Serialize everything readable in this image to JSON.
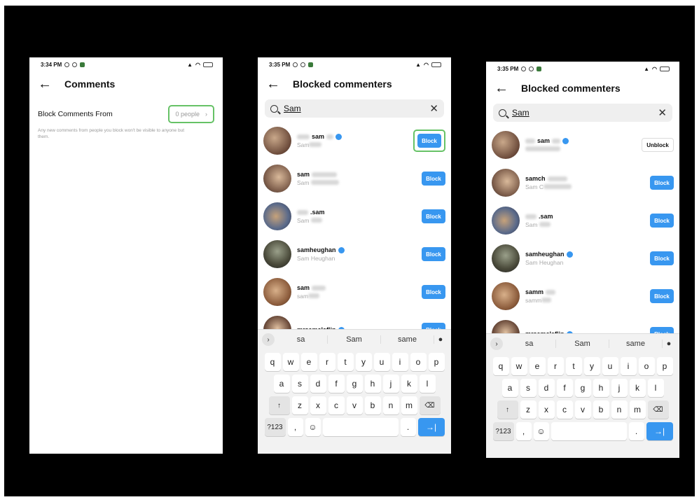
{
  "screens": {
    "p1": {
      "status_time": "3:34 PM",
      "title": "Comments",
      "block_label": "Block Comments From",
      "people_value": "0 people",
      "hint": "Any new comments from people you block won't be visible to anyone but them."
    },
    "p2": {
      "status_time": "3:35 PM",
      "title": "Blocked commenters",
      "search_value": "Sam",
      "rows": [
        {
          "username": "sam",
          "fullname": "Sam",
          "action": "Block",
          "verified": true
        },
        {
          "username": "sam",
          "fullname": "Sam",
          "action": "Block",
          "verified": false
        },
        {
          "username": ".sam",
          "fullname": "Sam",
          "action": "Block",
          "verified": false
        },
        {
          "username": "samheughan",
          "fullname": "Sam Heughan",
          "action": "Block",
          "verified": true
        },
        {
          "username": "sam",
          "fullname": "sam",
          "action": "Block",
          "verified": false
        },
        {
          "username": "mrsamclaflin",
          "fullname": "",
          "action": "Block",
          "verified": true
        }
      ]
    },
    "p3": {
      "status_time": "3:35 PM",
      "title": "Blocked commenters",
      "search_value": "Sam",
      "rows": [
        {
          "username": "sam",
          "fullname": "",
          "action": "Unblock",
          "verified": true
        },
        {
          "username": "samch",
          "fullname": "Sam C",
          "action": "Block",
          "verified": false
        },
        {
          "username": ".sam",
          "fullname": "Sam",
          "action": "Block",
          "verified": false
        },
        {
          "username": "samheughan",
          "fullname": "Sam Heughan",
          "action": "Block",
          "verified": true
        },
        {
          "username": "samm",
          "fullname": "samm",
          "action": "Block",
          "verified": false
        },
        {
          "username": "mrsamclaflin",
          "fullname": "",
          "action": "Block",
          "verified": true
        }
      ]
    }
  },
  "keyboard": {
    "suggestions": [
      "sa",
      "Sam",
      "same"
    ],
    "row1": [
      "q",
      "w",
      "e",
      "r",
      "t",
      "y",
      "u",
      "i",
      "o",
      "p"
    ],
    "row2": [
      "a",
      "s",
      "d",
      "f",
      "g",
      "h",
      "j",
      "k",
      "l"
    ],
    "row3": [
      "z",
      "x",
      "c",
      "v",
      "b",
      "n",
      "m"
    ],
    "sym_label": "?123",
    "comma": ",",
    "period": "."
  },
  "colors": {
    "accent": "#3897f0",
    "highlight": "#66c266",
    "frame": "#000000"
  }
}
